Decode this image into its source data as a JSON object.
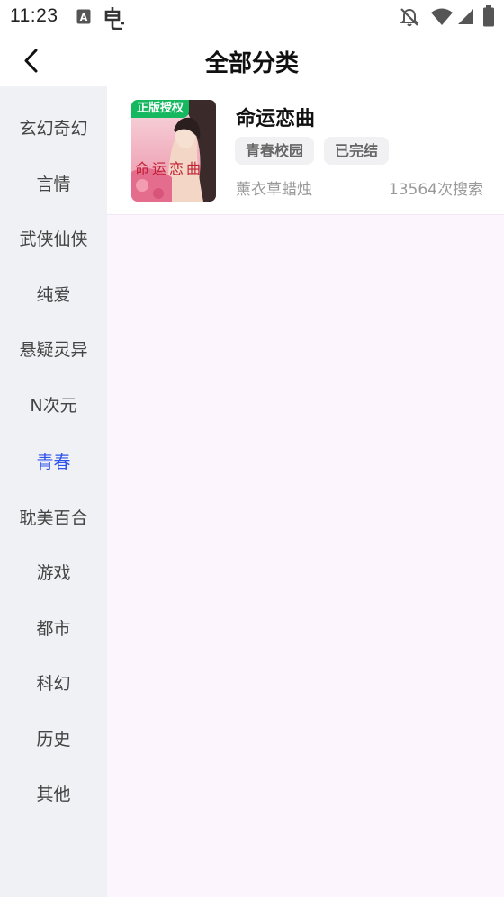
{
  "status_bar": {
    "time": "11:23"
  },
  "header": {
    "title": "全部分类"
  },
  "sidebar": {
    "items": [
      {
        "label": "玄幻奇幻"
      },
      {
        "label": "言情"
      },
      {
        "label": "武侠仙侠"
      },
      {
        "label": "纯爱"
      },
      {
        "label": "悬疑灵异"
      },
      {
        "label": "N次元"
      },
      {
        "label": "青春"
      },
      {
        "label": "耽美百合"
      },
      {
        "label": "游戏"
      },
      {
        "label": "都市"
      },
      {
        "label": "科幻"
      },
      {
        "label": "历史"
      },
      {
        "label": "其他"
      }
    ],
    "active_index": 6,
    "active_color": "#2f54eb"
  },
  "books": [
    {
      "title": "命运恋曲",
      "badge": "正版授权",
      "cover_text": "命运恋曲",
      "tags": [
        "青春校园",
        "已完结"
      ],
      "author": "薰衣草蜡烛",
      "search_count": "13564次搜索"
    }
  ],
  "colors": {
    "content_bg": "#fcf5fd",
    "sidebar_bg": "#f0f1f5",
    "badge_bg": "#15b85f"
  }
}
